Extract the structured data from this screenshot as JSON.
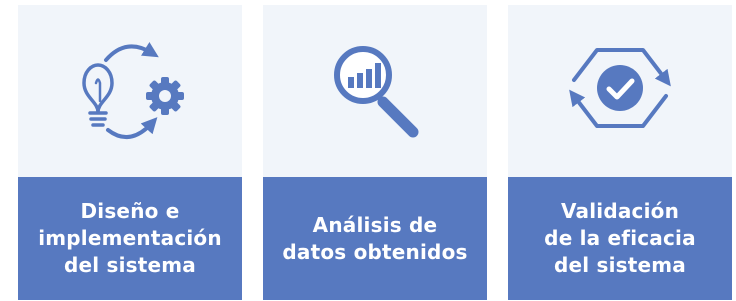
{
  "colors": {
    "card_background": "#f1f5fa",
    "label_background": "#5779c0",
    "icon": "#5779c0",
    "label_text": "#ffffff"
  },
  "cards": [
    {
      "icon": "lightbulb-gear-cycle-icon",
      "label": "Diseño e\nimplementación\ndel sistema"
    },
    {
      "icon": "magnifier-bar-chart-icon",
      "label": "Análisis de\ndatos obtenidos"
    },
    {
      "icon": "hexagon-check-cycle-icon",
      "label": "Validación\nde la eficacia\ndel sistema"
    }
  ]
}
